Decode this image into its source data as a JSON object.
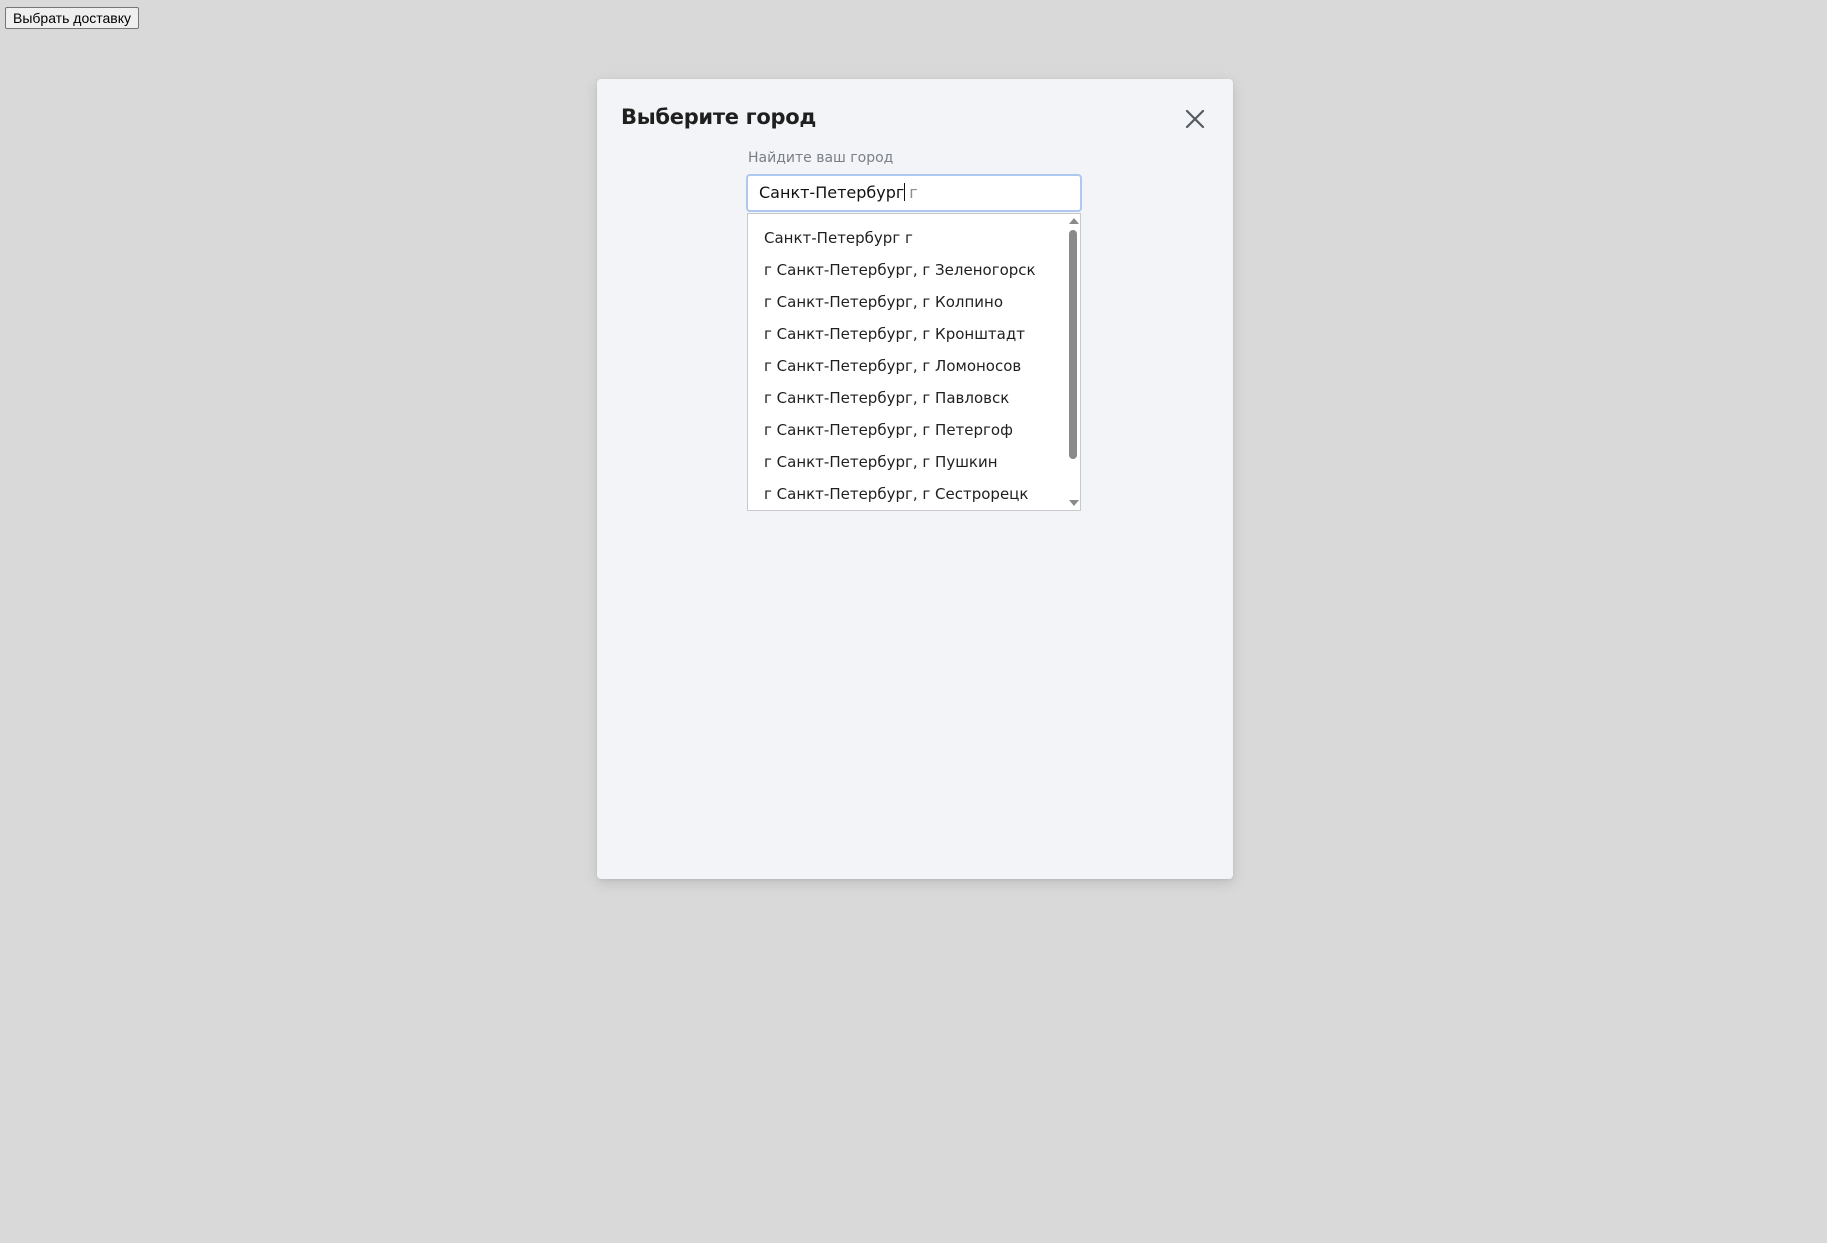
{
  "top_button": {
    "label": "Выбрать доставку"
  },
  "modal": {
    "title": "Выберите город",
    "close_icon": "close-icon",
    "search": {
      "label": "Найдите ваш город",
      "typed_value": "Санкт-Петербург",
      "autocomplete_tail": "г"
    },
    "suggestions": [
      {
        "label": "Санкт-Петербург г"
      },
      {
        "label": "г Санкт-Петербург, г Зеленогорск"
      },
      {
        "label": "г Санкт-Петербург, г Колпино"
      },
      {
        "label": "г Санкт-Петербург, г Кронштадт"
      },
      {
        "label": "г Санкт-Петербург, г Ломоносов"
      },
      {
        "label": "г Санкт-Петербург, г Павловск"
      },
      {
        "label": "г Санкт-Петербург, г Петергоф"
      },
      {
        "label": "г Санкт-Петербург, г Пушкин"
      },
      {
        "label": "г Санкт-Петербург, г Сестрорецк"
      }
    ]
  },
  "colors": {
    "page_bg": "#d9d9d9",
    "modal_bg": "#f2f4f7",
    "input_focus_border": "#aec8ef",
    "label_text": "#7a7f87",
    "scroll_thumb": "#8a8a8a"
  }
}
